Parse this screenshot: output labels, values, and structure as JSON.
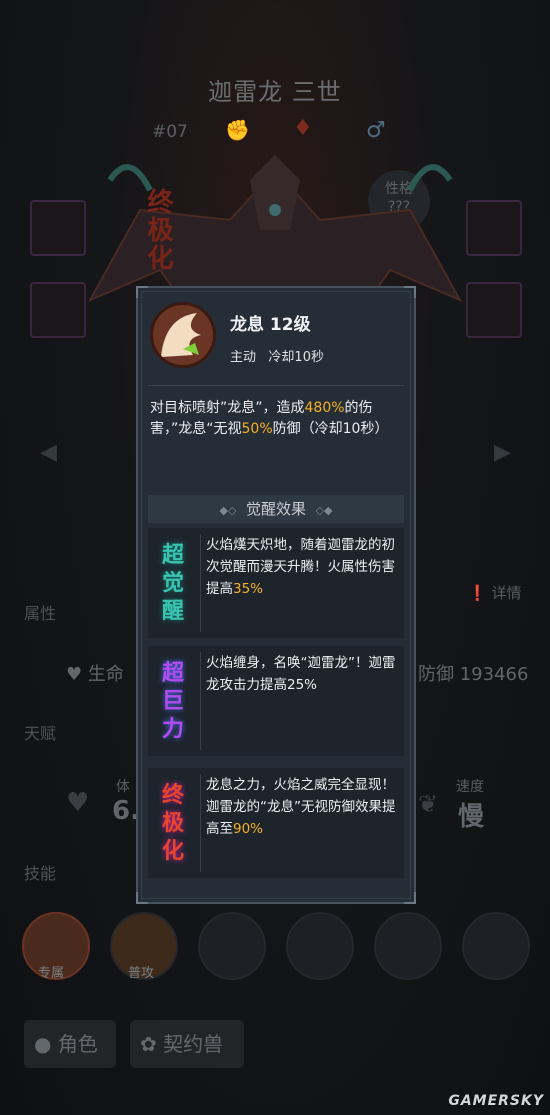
{
  "hero": {
    "title": "迦雷龙 三世",
    "number": "#07",
    "character_label": "性格",
    "character_value": "???",
    "badge": "终极化"
  },
  "background": {
    "attr_label": "属性",
    "talent_label": "天赋",
    "skill_label": "技能",
    "detail_label": "详情",
    "life_label": "生命",
    "defense_label": "防御",
    "defense_value": "193466",
    "stat1_label": "体",
    "stat1_value": "6.",
    "speed_label": "速度",
    "speed_value": "慢",
    "skill1_tag": "专属",
    "skill2_tag": "普攻",
    "tab_role": "角色",
    "tab_pet": "契约兽"
  },
  "popup": {
    "skill_name": "龙息 12级",
    "skill_type": "主动",
    "cooldown": "冷却10秒",
    "desc_part1": "对目标喷射”龙息”，造成",
    "desc_hl1": "480%",
    "desc_part2": "的伤害，”龙息“无视",
    "desc_hl2": "50%",
    "desc_part3": "防御（冷却10秒）",
    "section_title": "觉醒效果",
    "awakenings": [
      {
        "badge": "超觉醒",
        "text": "火焰熯天炽地，随着迦雷龙的初次觉醒而漫天升腾！火属性伤害提高",
        "hl": "35%",
        "color": "#39c4b2"
      },
      {
        "badge": "超巨力",
        "text": "火焰缠身，名唤“迦雷龙”！迦雷龙攻击力提高25%",
        "hl": "",
        "color": "#b24cf0"
      },
      {
        "badge": "终极化",
        "text": "龙息之力，火焰之威完全显现！迦雷龙的“龙息”无视防御效果提高至",
        "hl": "90%",
        "color": "#e8452a"
      }
    ]
  },
  "watermark": "GAMERSKY",
  "colors": {
    "highlight": "#f6b022",
    "panel": "#252d36"
  }
}
